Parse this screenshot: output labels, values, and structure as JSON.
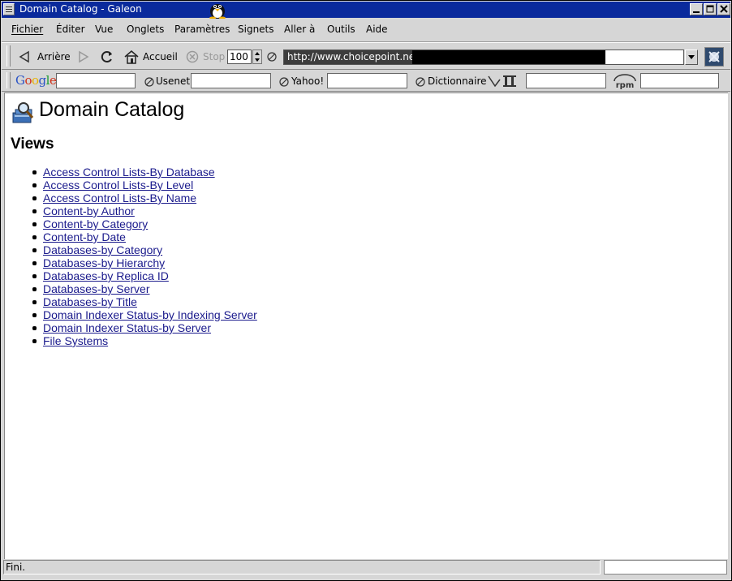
{
  "window": {
    "title": "Domain Catalog - Galeon"
  },
  "menubar": {
    "items": [
      {
        "label": "Fichier"
      },
      {
        "label": "Éditer"
      },
      {
        "label": "Vue"
      },
      {
        "label": "Onglets"
      },
      {
        "label": "Paramètres"
      },
      {
        "label": "Signets"
      },
      {
        "label": "Aller à"
      },
      {
        "label": "Outils"
      },
      {
        "label": "Aide"
      }
    ]
  },
  "navbar": {
    "back_label": "Arrière",
    "home_label": "Accueil",
    "stop_label": "Stop",
    "zoom": "100",
    "url": "http://www.choicepoint.net/c"
  },
  "searchbar": {
    "google_label": "Google",
    "usenet_label": "Usenet",
    "yahoo_label": "Yahoo!",
    "dictionary_label": "Dictionnaire",
    "rpm_label": "rpm"
  },
  "content": {
    "title": "Domain Catalog",
    "views_heading": "Views",
    "links": [
      "Access Control Lists-By Database",
      "Access Control Lists-By Level",
      "Access Control Lists-By Name",
      "Content-by Author",
      "Content-by Category",
      "Content-by Date",
      "Databases-by Category",
      "Databases-by Hierarchy",
      "Databases-by Replica ID",
      "Databases-by Server",
      "Databases-by Title",
      "Domain Indexer Status-by Indexing Server",
      "Domain Indexer Status-by Server",
      "File Systems"
    ]
  },
  "statusbar": {
    "text": "Fini."
  },
  "colors": {
    "titlebar": "#0a2a9c",
    "link": "#1a1a8c",
    "chrome": "#d6d6d6"
  }
}
